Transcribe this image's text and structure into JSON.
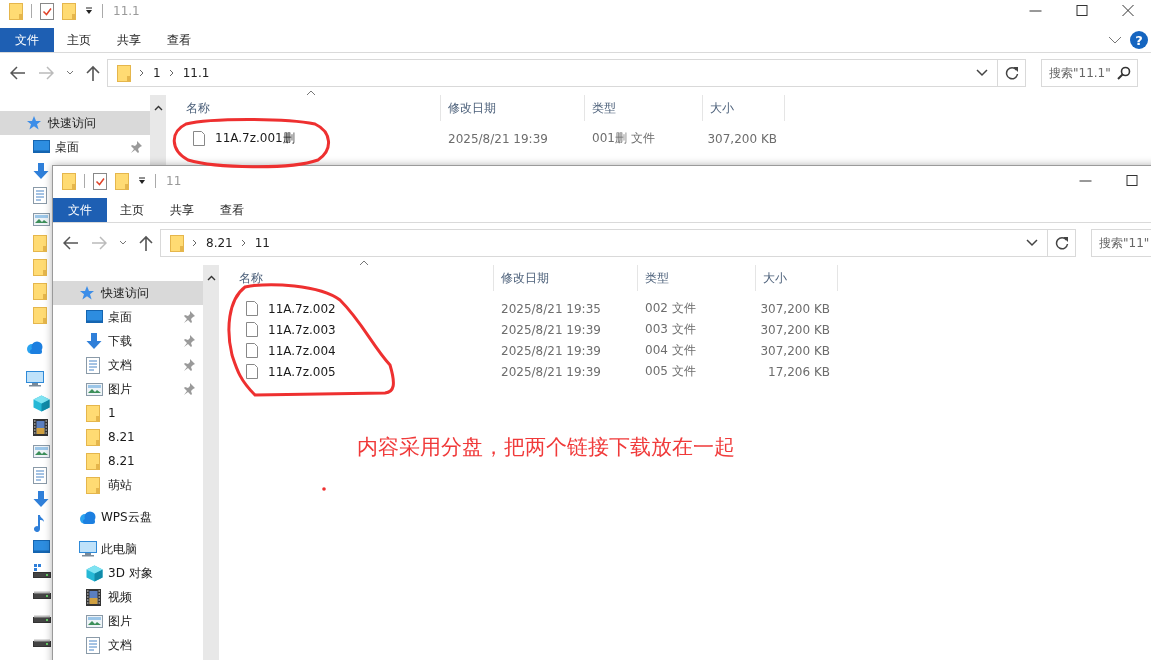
{
  "windows": [
    {
      "title": "11.1",
      "help": "?",
      "caption_buttons": [
        {
          "kind": "minimize"
        },
        {
          "kind": "maximize"
        },
        {
          "kind": "close"
        }
      ],
      "tabs": [
        {
          "label": "文件",
          "selected": true
        },
        {
          "label": "主页",
          "selected": false
        },
        {
          "label": "共享",
          "selected": false
        },
        {
          "label": "查看",
          "selected": false
        }
      ],
      "path": [
        "1",
        "11.1"
      ],
      "search": {
        "placeholder": "搜索\"11.1\"",
        "icon": true
      },
      "nav": [
        {
          "label": "快速访问",
          "kind": "star",
          "selected": true,
          "children": [
            {
              "label": "桌面",
              "kind": "desktop",
              "pinned": true,
              "selected": false
            },
            {
              "kind": "download",
              "selected": false
            },
            {
              "kind": "document",
              "selected": false
            },
            {
              "kind": "pictures",
              "selected": false
            },
            {
              "kind": "folder",
              "selected": false
            },
            {
              "kind": "folder",
              "selected": false
            },
            {
              "kind": "folder",
              "selected": false
            },
            {
              "kind": "folder",
              "selected": false
            }
          ]
        },
        {
          "kind": "cloud",
          "selected": false
        },
        {
          "kind": "computer",
          "selected": false,
          "children": [
            {
              "kind": "cube",
              "selected": false
            },
            {
              "kind": "video",
              "selected": false
            },
            {
              "kind": "pictures",
              "selected": false
            },
            {
              "kind": "document",
              "selected": false
            },
            {
              "kind": "download",
              "selected": false
            },
            {
              "kind": "music",
              "selected": false
            },
            {
              "kind": "desktop",
              "selected": false
            },
            {
              "kind": "system-drive",
              "selected": false
            },
            {
              "kind": "drive",
              "selected": false
            },
            {
              "kind": "drive",
              "selected": false
            },
            {
              "kind": "drive",
              "selected": false
            }
          ]
        }
      ],
      "columns": [
        "名称",
        "修改日期",
        "类型",
        "大小"
      ],
      "files": [
        {
          "name": "11A.7z.001删",
          "modified": "2025/8/21 19:39",
          "type": "001删 文件",
          "size": "307,200 KB"
        }
      ]
    },
    {
      "title": "11",
      "caption_buttons": [
        {
          "kind": "minimize"
        },
        {
          "kind": "maximize"
        }
      ],
      "tabs": [
        {
          "label": "文件",
          "selected": true
        },
        {
          "label": "主页",
          "selected": false
        },
        {
          "label": "共享",
          "selected": false
        },
        {
          "label": "查看",
          "selected": false
        }
      ],
      "path": [
        "8.21",
        "11"
      ],
      "search": {
        "placeholder": "搜索\"11\""
      },
      "nav": [
        {
          "label": "快速访问",
          "kind": "star",
          "selected": true,
          "children": [
            {
              "label": "桌面",
              "kind": "desktop",
              "pinned": true,
              "selected": false
            },
            {
              "label": "下载",
              "kind": "download",
              "pinned": true,
              "selected": false
            },
            {
              "label": "文档",
              "kind": "document",
              "pinned": true,
              "selected": false
            },
            {
              "label": "图片",
              "kind": "pictures",
              "pinned": true,
              "selected": false
            },
            {
              "label": "1",
              "kind": "folder",
              "pinned": false,
              "selected": false
            },
            {
              "label": "8.21",
              "kind": "folder",
              "pinned": false,
              "selected": false
            },
            {
              "label": "8.21",
              "kind": "folder",
              "pinned": false,
              "selected": false
            },
            {
              "label": "萌站",
              "kind": "folder",
              "pinned": false,
              "selected": false
            }
          ]
        },
        {
          "label": "WPS云盘",
          "kind": "cloud",
          "selected": false
        },
        {
          "label": "此电脑",
          "kind": "computer",
          "selected": false,
          "children": [
            {
              "label": "3D 对象",
              "kind": "cube",
              "selected": false
            },
            {
              "label": "视频",
              "kind": "video",
              "selected": false
            },
            {
              "label": "图片",
              "kind": "pictures",
              "selected": false
            },
            {
              "label": "文档",
              "kind": "document",
              "selected": false
            }
          ]
        }
      ],
      "columns": [
        "名称",
        "修改日期",
        "类型",
        "大小"
      ],
      "files": [
        {
          "name": "11A.7z.002",
          "modified": "2025/8/21 19:35",
          "type": "002 文件",
          "size": "307,200 KB"
        },
        {
          "name": "11A.7z.003",
          "modified": "2025/8/21 19:39",
          "type": "003 文件",
          "size": "307,200 KB"
        },
        {
          "name": "11A.7z.004",
          "modified": "2025/8/21 19:39",
          "type": "004 文件",
          "size": "307,200 KB"
        },
        {
          "name": "11A.7z.005",
          "modified": "2025/8/21 19:39",
          "type": "005 文件",
          "size": "17,206 KB"
        }
      ]
    }
  ],
  "annotation": {
    "text": "内容采用分盘，把两个链接下载放在一起"
  }
}
